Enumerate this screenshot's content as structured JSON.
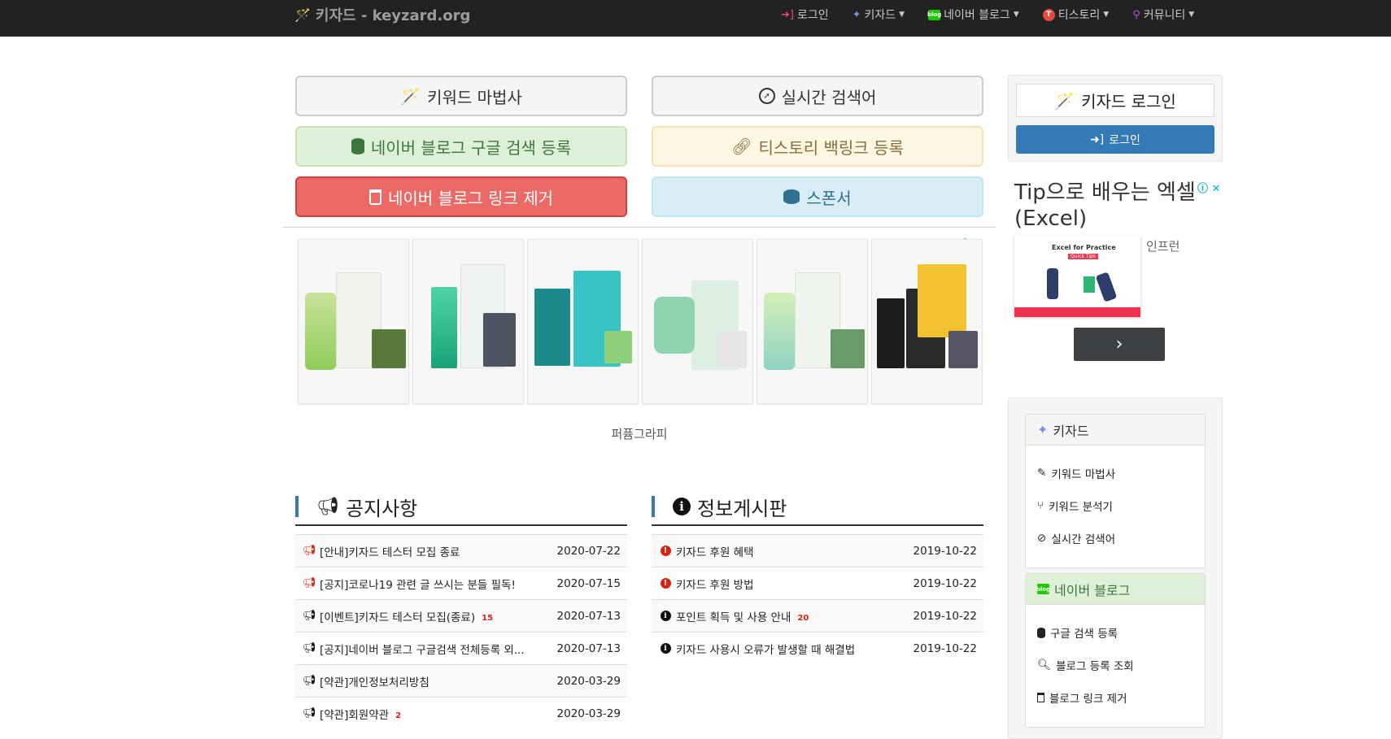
{
  "navbar": {
    "brand": "키자드 - keyzard.org",
    "items": [
      {
        "label": "로그인",
        "icon": "sign-in-icon"
      },
      {
        "label": "키자드",
        "icon": "magic-wand-icon"
      },
      {
        "label": "네이버 블로그",
        "icon": "naver-blog-icon"
      },
      {
        "label": "티스토리",
        "icon": "tistory-icon"
      },
      {
        "label": "커뮤니티",
        "icon": "community-icon"
      }
    ]
  },
  "buttons": {
    "keyword_wizard": "키워드 마법사",
    "realtime_search": "실시간 검색어",
    "naver_google_register": "네이버 블로그 구글 검색 등록",
    "tistory_backlink": "티스토리 백링크 등록",
    "naver_link_remove": "네이버 블로그 링크 제거",
    "sponsor": "스폰서"
  },
  "ad": {
    "caption": "퍼퓸그라피",
    "close_icon": "ⓘ ✕"
  },
  "notice": {
    "title": "공지사항",
    "rows": [
      {
        "text": "[안내]키자드 테스터 모집 종료",
        "date": "2020-07-22",
        "badge": "",
        "icon_color": "#d9230f"
      },
      {
        "text": "[공지]코로나19 관련 글 쓰시는 분들 필독!",
        "date": "2020-07-15",
        "badge": "",
        "icon_color": "#d9230f"
      },
      {
        "text": "[이벤트]키자드 테스터 모집(종료)",
        "date": "2020-07-13",
        "badge": "15",
        "icon_color": "#111111"
      },
      {
        "text": "[공지]네이버 블로그 구글검색 전체등록 외...",
        "date": "2020-07-13",
        "badge": "",
        "icon_color": "#111111"
      },
      {
        "text": "[약관]개인정보처리방침",
        "date": "2020-03-29",
        "badge": "",
        "icon_color": "#111111"
      },
      {
        "text": "[약관]회원약관",
        "date": "2020-03-29",
        "badge": "2",
        "icon_color": "#111111"
      }
    ]
  },
  "info": {
    "title": "정보게시판",
    "rows": [
      {
        "text": "키자드 후원 혜택",
        "date": "2019-10-22",
        "badge": "",
        "icon_color": "#d9230f"
      },
      {
        "text": "키자드 후원 방법",
        "date": "2019-10-22",
        "badge": "",
        "icon_color": "#d9230f"
      },
      {
        "text": "포인트 획득 및 사용 안내",
        "date": "2019-10-22",
        "badge": "20",
        "icon_color": "#111111"
      },
      {
        "text": "키자드 사용시 오류가 발생할 때 해결법",
        "date": "2019-10-22",
        "badge": "",
        "icon_color": "#111111"
      }
    ]
  },
  "sidebar": {
    "login_title": "키자드 로그인",
    "login_button": "로그인",
    "ad_title": "Tip으로 배우는 엑셀(Excel)",
    "ad_brand": "인프런",
    "ad_image_title": "Excel for Practice",
    "ad_image_tag": "Quick Tips",
    "keyzard_panel": {
      "title": "키자드",
      "items": [
        "키워드 마법사",
        "키워드 분석기",
        "실시간 검색어"
      ]
    },
    "naver_panel": {
      "title": "네이버 블로그",
      "items": [
        "구글 검색 등록",
        "블로그 등록 조회",
        "블로그 링크 제거"
      ]
    }
  },
  "colors": {
    "navbar_bg": "#222222",
    "primary": "#337ab7",
    "danger": "#d9230f",
    "success_bg": "#dff0d8"
  }
}
